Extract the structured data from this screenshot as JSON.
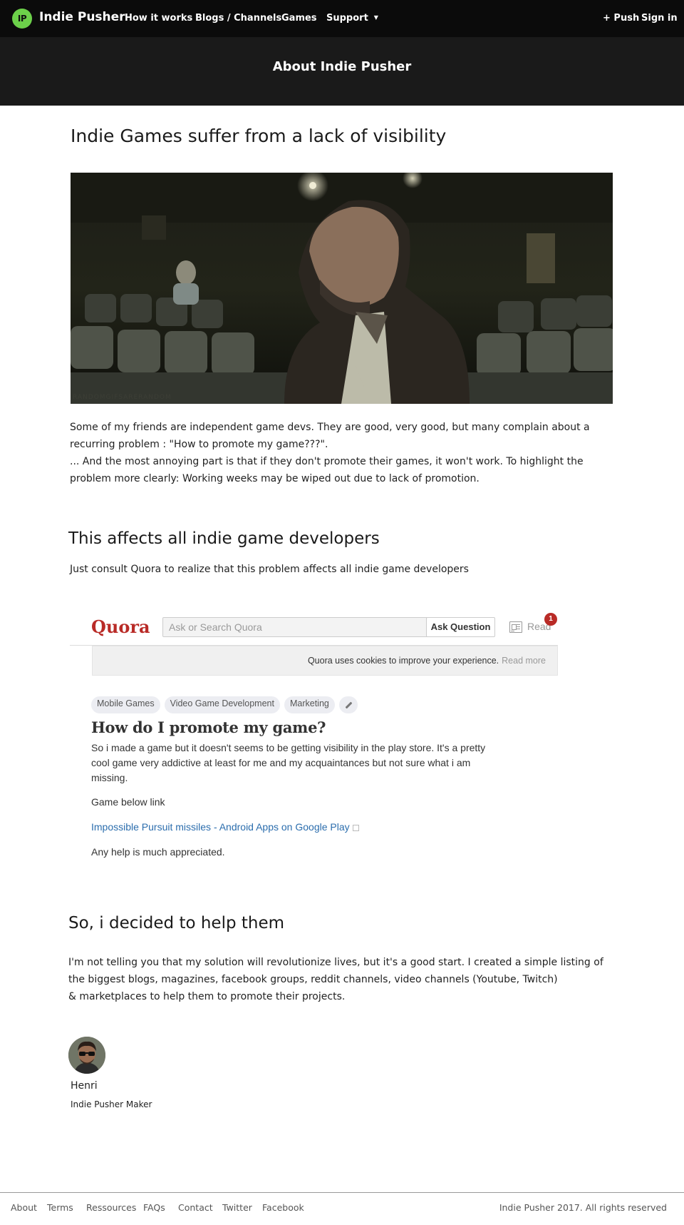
{
  "nav": {
    "logo_text": "IP",
    "brand": "Indie Pusher",
    "links": [
      "How it works",
      "Blogs / Channels",
      "Games",
      "Support"
    ],
    "push": "+ Push",
    "signin": "Sign in"
  },
  "hero": {
    "title": "About Indie Pusher"
  },
  "section1": {
    "heading": "Indie Games suffer from a lack of visibility",
    "image_watermark": "RANDOMGIFSARERANDOM",
    "p1": "Some of my friends are independent game devs. They are good, very good, but many complain about a recurring problem : \"How to promote my game???\".",
    "p2": "... And the most annoying part is that if they don't promote their games, it won't work. To highlight the problem more clearly: Working weeks may be wiped out due to lack of promotion."
  },
  "section2": {
    "heading": "This affects all indie game developers",
    "text": "Just consult Quora to realize that this problem affects all indie game developers"
  },
  "quora": {
    "logo": "Quora",
    "search_placeholder": "Ask or Search Quora",
    "ask_button": "Ask Question",
    "read_label": "Read",
    "badge_count": "1",
    "cookie_text": "Quora uses cookies to improve your experience.",
    "cookie_more": "Read more",
    "tags": [
      "Mobile Games",
      "Video Game Development",
      "Marketing"
    ],
    "question": "How do I promote my game?",
    "body": "So i made a game but it doesn't seems to be getting visibility in the play store. It's a pretty cool game very addictive at least for me and my acquaintances but not sure what i am missing.",
    "line2": "Game below link",
    "link": "Impossible Pursuit missiles - Android Apps on Google Play",
    "line3": "Any help is much appreciated."
  },
  "section3": {
    "heading": "So, i decided to help them",
    "text1": "I'm not telling you that my solution will revolutionize lives, but it's a good start. I created a simple listing of the biggest blogs, magazines, facebook groups, reddit channels, video channels (Youtube, Twitch)",
    "text2": "& marketplaces to help them to promote their projects."
  },
  "author": {
    "name": "Henri",
    "role": "Indie Pusher Maker"
  },
  "footer": {
    "links": [
      "About",
      "Terms",
      "Ressources",
      "FAQs",
      "Contact",
      "Twitter",
      "Facebook"
    ],
    "copyright": "Indie Pusher 2017. All rights reserved"
  }
}
